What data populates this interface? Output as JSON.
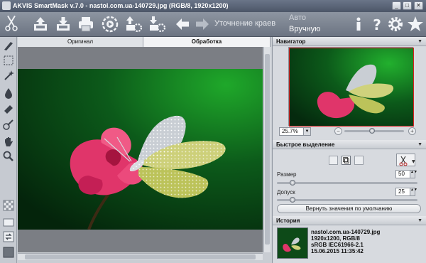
{
  "window": {
    "title": "AKVIS SmartMask v.7.0 - nastol.com.ua-140729.jpg (RGB/8, 1920x1200)",
    "controls": [
      "_",
      "□",
      "✕"
    ]
  },
  "toolbar": {
    "refine_label": "Уточнение краев",
    "mode_auto": "Авто",
    "mode_manual": "Вручную",
    "icons": [
      "scissors-logo-icon",
      "open-icon",
      "save-icon",
      "print-icon",
      "run-icon",
      "settings-up-icon",
      "settings-down-icon",
      "undo-icon",
      "redo-icon",
      "info-icon",
      "help-icon",
      "preferences-icon",
      "star-icon"
    ]
  },
  "tabs": {
    "original": "Оригинал",
    "processing": "Обработка"
  },
  "navigator": {
    "title": "Навигатор",
    "zoom": "25.7%",
    "zoom_fraction": 0.46
  },
  "quick_selection": {
    "title": "Быстрое выделение",
    "size_label": "Размер",
    "size_value": "50",
    "size_fraction": 0.11,
    "tolerance_label": "Допуск",
    "tolerance_value": "25",
    "tolerance_fraction": 0.11,
    "reset_label": "Вернуть значения по умолчанию"
  },
  "history": {
    "title": "История",
    "entry_name": "nastol.com.ua-140729.jpg",
    "entry_size": "1920x1200, RGB/8",
    "entry_profile": "sRGB IEC61966-2.1",
    "entry_date": "15.06.2015 11:35:42"
  }
}
